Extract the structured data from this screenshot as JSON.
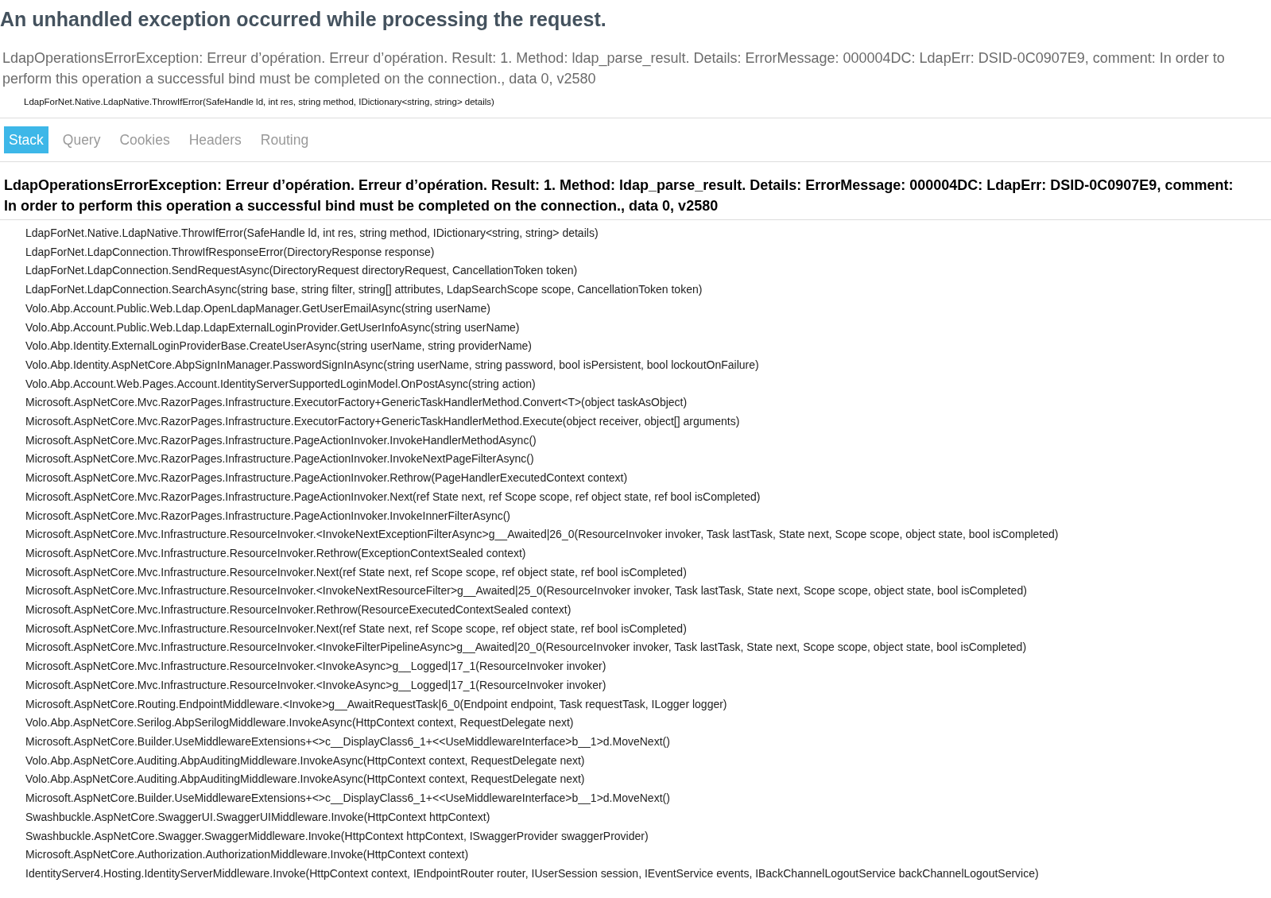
{
  "title": "An unhandled exception occurred while processing the request.",
  "summary": {
    "message": "LdapOperationsErrorException: Erreur d’opération. Erreur d’opération. Result: 1. Method: ldap_parse_result. Details: ErrorMessage: 000004DC: LdapErr: DSID-0C0907E9, comment: In order to perform this operation a successful bind must be completed on the connection., data 0, v2580",
    "location": "LdapForNet.Native.LdapNative.ThrowIfError(SafeHandle ld, int res, string method, IDictionary<string, string> details)"
  },
  "tabs": [
    {
      "label": "Stack",
      "selected": true
    },
    {
      "label": "Query",
      "selected": false
    },
    {
      "label": "Cookies",
      "selected": false
    },
    {
      "label": "Headers",
      "selected": false
    },
    {
      "label": "Routing",
      "selected": false
    }
  ],
  "stack": {
    "heading": "LdapOperationsErrorException: Erreur d’opération. Erreur d’opération. Result: 1. Method: ldap_parse_result. Details: ErrorMessage: 000004DC: LdapErr: DSID-0C0907E9, comment: In order to perform this operation a successful bind must be completed on the connection., data 0, v2580",
    "frames": [
      "LdapForNet.Native.LdapNative.ThrowIfError(SafeHandle ld, int res, string method, IDictionary<string, string> details)",
      "LdapForNet.LdapConnection.ThrowIfResponseError(DirectoryResponse response)",
      "LdapForNet.LdapConnection.SendRequestAsync(DirectoryRequest directoryRequest, CancellationToken token)",
      "LdapForNet.LdapConnection.SearchAsync(string base, string filter, string[] attributes, LdapSearchScope scope, CancellationToken token)",
      "Volo.Abp.Account.Public.Web.Ldap.OpenLdapManager.GetUserEmailAsync(string userName)",
      "Volo.Abp.Account.Public.Web.Ldap.LdapExternalLoginProvider.GetUserInfoAsync(string userName)",
      "Volo.Abp.Identity.ExternalLoginProviderBase.CreateUserAsync(string userName, string providerName)",
      "Volo.Abp.Identity.AspNetCore.AbpSignInManager.PasswordSignInAsync(string userName, string password, bool isPersistent, bool lockoutOnFailure)",
      "Volo.Abp.Account.Web.Pages.Account.IdentityServerSupportedLoginModel.OnPostAsync(string action)",
      "Microsoft.AspNetCore.Mvc.RazorPages.Infrastructure.ExecutorFactory+GenericTaskHandlerMethod.Convert<T>(object taskAsObject)",
      "Microsoft.AspNetCore.Mvc.RazorPages.Infrastructure.ExecutorFactory+GenericTaskHandlerMethod.Execute(object receiver, object[] arguments)",
      "Microsoft.AspNetCore.Mvc.RazorPages.Infrastructure.PageActionInvoker.InvokeHandlerMethodAsync()",
      "Microsoft.AspNetCore.Mvc.RazorPages.Infrastructure.PageActionInvoker.InvokeNextPageFilterAsync()",
      "Microsoft.AspNetCore.Mvc.RazorPages.Infrastructure.PageActionInvoker.Rethrow(PageHandlerExecutedContext context)",
      "Microsoft.AspNetCore.Mvc.RazorPages.Infrastructure.PageActionInvoker.Next(ref State next, ref Scope scope, ref object state, ref bool isCompleted)",
      "Microsoft.AspNetCore.Mvc.RazorPages.Infrastructure.PageActionInvoker.InvokeInnerFilterAsync()",
      "Microsoft.AspNetCore.Mvc.Infrastructure.ResourceInvoker.<InvokeNextExceptionFilterAsync>g__Awaited|26_0(ResourceInvoker invoker, Task lastTask, State next, Scope scope, object state, bool isCompleted)",
      "Microsoft.AspNetCore.Mvc.Infrastructure.ResourceInvoker.Rethrow(ExceptionContextSealed context)",
      "Microsoft.AspNetCore.Mvc.Infrastructure.ResourceInvoker.Next(ref State next, ref Scope scope, ref object state, ref bool isCompleted)",
      "Microsoft.AspNetCore.Mvc.Infrastructure.ResourceInvoker.<InvokeNextResourceFilter>g__Awaited|25_0(ResourceInvoker invoker, Task lastTask, State next, Scope scope, object state, bool isCompleted)",
      "Microsoft.AspNetCore.Mvc.Infrastructure.ResourceInvoker.Rethrow(ResourceExecutedContextSealed context)",
      "Microsoft.AspNetCore.Mvc.Infrastructure.ResourceInvoker.Next(ref State next, ref Scope scope, ref object state, ref bool isCompleted)",
      "Microsoft.AspNetCore.Mvc.Infrastructure.ResourceInvoker.<InvokeFilterPipelineAsync>g__Awaited|20_0(ResourceInvoker invoker, Task lastTask, State next, Scope scope, object state, bool isCompleted)",
      "Microsoft.AspNetCore.Mvc.Infrastructure.ResourceInvoker.<InvokeAsync>g__Logged|17_1(ResourceInvoker invoker)",
      "Microsoft.AspNetCore.Mvc.Infrastructure.ResourceInvoker.<InvokeAsync>g__Logged|17_1(ResourceInvoker invoker)",
      "Microsoft.AspNetCore.Routing.EndpointMiddleware.<Invoke>g__AwaitRequestTask|6_0(Endpoint endpoint, Task requestTask, ILogger logger)",
      "Volo.Abp.AspNetCore.Serilog.AbpSerilogMiddleware.InvokeAsync(HttpContext context, RequestDelegate next)",
      "Microsoft.AspNetCore.Builder.UseMiddlewareExtensions+<>c__DisplayClass6_1+<<UseMiddlewareInterface>b__1>d.MoveNext()",
      "Volo.Abp.AspNetCore.Auditing.AbpAuditingMiddleware.InvokeAsync(HttpContext context, RequestDelegate next)",
      "Volo.Abp.AspNetCore.Auditing.AbpAuditingMiddleware.InvokeAsync(HttpContext context, RequestDelegate next)",
      "Microsoft.AspNetCore.Builder.UseMiddlewareExtensions+<>c__DisplayClass6_1+<<UseMiddlewareInterface>b__1>d.MoveNext()",
      "Swashbuckle.AspNetCore.SwaggerUI.SwaggerUIMiddleware.Invoke(HttpContext httpContext)",
      "Swashbuckle.AspNetCore.Swagger.SwaggerMiddleware.Invoke(HttpContext httpContext, ISwaggerProvider swaggerProvider)",
      "Microsoft.AspNetCore.Authorization.AuthorizationMiddleware.Invoke(HttpContext context)",
      "IdentityServer4.Hosting.IdentityServerMiddleware.Invoke(HttpContext context, IEndpointRouter router, IUserSession session, IEventService events, IBackChannelLogoutService backChannelLogoutService)"
    ]
  }
}
